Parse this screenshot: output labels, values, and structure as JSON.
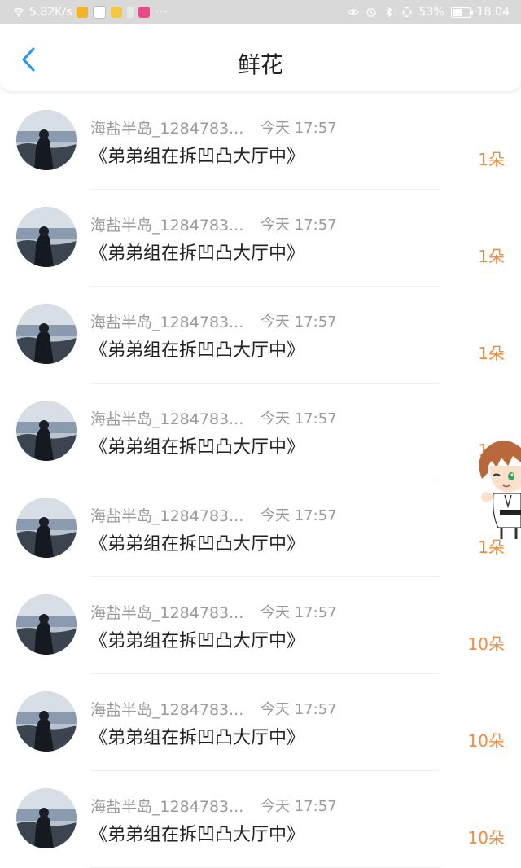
{
  "status_bar": {
    "net_speed": "5.82K/s",
    "battery": "53%",
    "battery_level": 0.53,
    "time": "18:04",
    "more": "···"
  },
  "header": {
    "title": "鲜花",
    "back_icon": "chevron-left-icon"
  },
  "records": [
    {
      "user": "海盐半岛_1284783...",
      "time": "今天 17:57",
      "book": "《弟弟组在拆凹凸大厅中》",
      "amount": "1朵"
    },
    {
      "user": "海盐半岛_1284783...",
      "time": "今天 17:57",
      "book": "《弟弟组在拆凹凸大厅中》",
      "amount": "1朵"
    },
    {
      "user": "海盐半岛_1284783...",
      "time": "今天 17:57",
      "book": "《弟弟组在拆凹凸大厅中》",
      "amount": "1朵"
    },
    {
      "user": "海盐半岛_1284783...",
      "time": "今天 17:57",
      "book": "《弟弟组在拆凹凸大厅中》",
      "amount": "1朵"
    },
    {
      "user": "海盐半岛_1284783...",
      "time": "今天 17:57",
      "book": "《弟弟组在拆凹凸大厅中》",
      "amount": "1朵"
    },
    {
      "user": "海盐半岛_1284783...",
      "time": "今天 17:57",
      "book": "《弟弟组在拆凹凸大厅中》",
      "amount": "10朵"
    },
    {
      "user": "海盐半岛_1284783...",
      "time": "今天 17:57",
      "book": "《弟弟组在拆凹凸大厅中》",
      "amount": "10朵"
    },
    {
      "user": "海盐半岛_1284783...",
      "time": "今天 17:57",
      "book": "《弟弟组在拆凹凸大厅中》",
      "amount": "10朵"
    }
  ],
  "colors": {
    "accent": "#2196F3",
    "amount": "#f08a3c",
    "muted_text": "#9a9a9a"
  }
}
